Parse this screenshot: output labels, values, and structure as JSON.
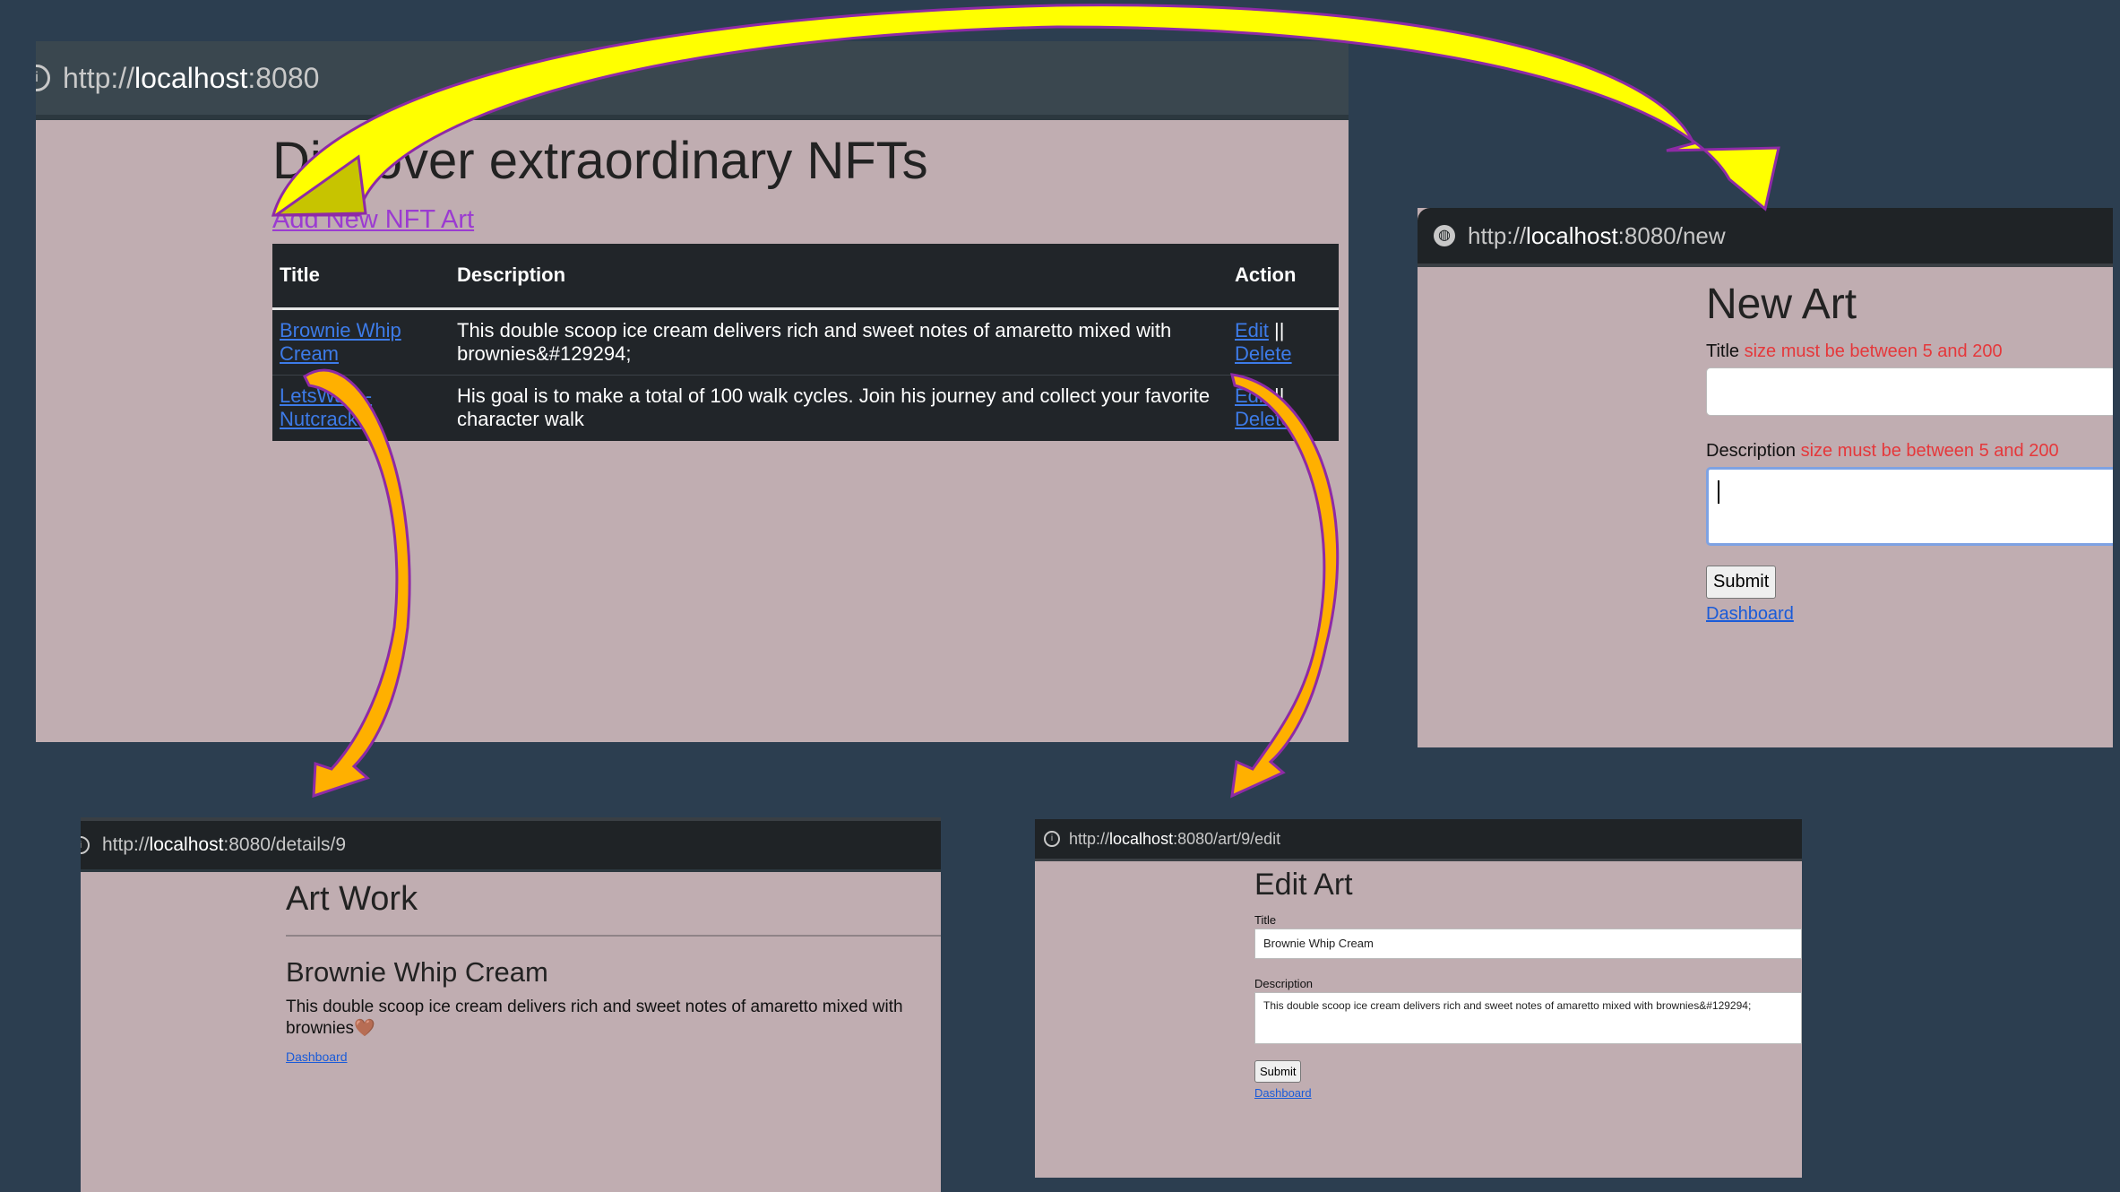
{
  "dashboard_window": {
    "url": {
      "prefix": "http://",
      "host": "localhost",
      "rest": ":8080"
    },
    "heading": "Discover extraordinary NFTs",
    "add_link": "Add New NFT Art",
    "columns": [
      "Title",
      "Description",
      "Action"
    ],
    "rows": [
      {
        "title": "Brownie Whip Cream",
        "description": "This double scoop ice cream delivers rich and sweet notes of amaretto mixed with brownies&#129294;",
        "edit": "Edit",
        "separator": "||",
        "delete": "Delete"
      },
      {
        "title": "LetsWalk - Nutcracker",
        "description": "His goal is to make a total of 100 walk cycles. Join his journey and collect your favorite character walk",
        "edit": "Edit",
        "separator": "||",
        "delete": "Delete"
      }
    ]
  },
  "new_window": {
    "url": {
      "prefix": "http://",
      "host": "localhost",
      "rest": ":8080/new"
    },
    "heading": "New Art",
    "title_label": "Title",
    "title_error": "size must be between 5 and 200",
    "title_value": "",
    "description_label": "Description",
    "description_error": "size must be between 5 and 200",
    "description_value": "",
    "submit": "Submit",
    "dashboard_link": "Dashboard"
  },
  "details_window": {
    "url": {
      "prefix": "http://",
      "host": "localhost",
      "rest": ":8080/details/9"
    },
    "heading": "Art Work",
    "art_title": "Brownie Whip Cream",
    "art_description": "This double scoop ice cream delivers rich and sweet notes of amaretto mixed with brownies",
    "heart_emoji": "🤎",
    "dashboard_link": "Dashboard"
  },
  "edit_window": {
    "url": {
      "prefix": "http://",
      "host": "localhost",
      "rest": ":8080/art/9/edit"
    },
    "heading": "Edit Art",
    "title_label": "Title",
    "title_value": "Brownie Whip Cream",
    "description_label": "Description",
    "description_value": "This double scoop ice cream delivers rich and sweet notes of amaretto mixed with brownies&#129294;",
    "submit": "Submit",
    "dashboard_link": "Dashboard"
  },
  "colors": {
    "background": "#2c3e50",
    "page": "#c0adb1",
    "table": "#212529",
    "link": "#1a5bd8",
    "visited_link": "#9b3bd1",
    "error": "#e5383b",
    "arrow_yellow": "#ffff00",
    "arrow_orange": "#ffb000",
    "arrow_outline": "#8e2aa6"
  }
}
